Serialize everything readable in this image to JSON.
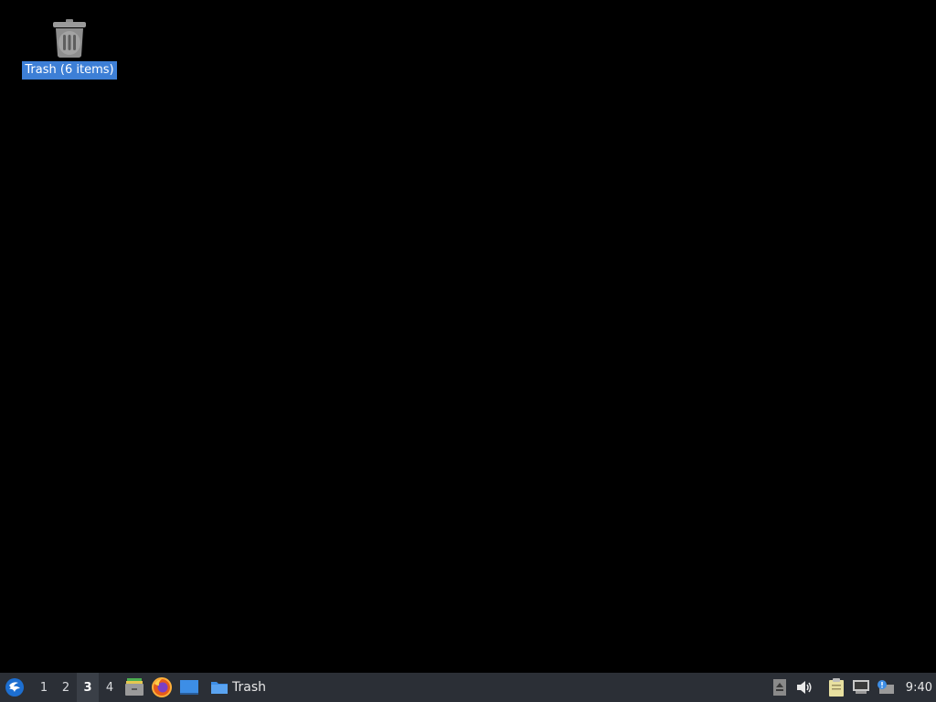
{
  "desktop": {
    "background_color": "#000000",
    "icons": [
      {
        "label": "Trash (6 items)",
        "icon": "trash-icon",
        "selected": true
      }
    ]
  },
  "panel": {
    "menu_icon": "lubuntu-menu-icon",
    "workspaces": [
      {
        "label": "1",
        "active": false
      },
      {
        "label": "2",
        "active": false
      },
      {
        "label": "3",
        "active": true
      },
      {
        "label": "4",
        "active": false
      }
    ],
    "launchers": [
      {
        "icon": "file-manager-icon"
      },
      {
        "icon": "firefox-icon"
      },
      {
        "icon": "show-desktop-icon"
      }
    ],
    "tasks": [
      {
        "label": "Trash",
        "icon": "folder-icon"
      }
    ],
    "tray": [
      {
        "icon": "eject-icon"
      },
      {
        "icon": "volume-icon"
      },
      {
        "icon": "clipboard-icon"
      },
      {
        "icon": "network-icon"
      },
      {
        "icon": "update-notifier-icon"
      }
    ],
    "clock": "9:40"
  },
  "colors": {
    "panel": "#2b2f36",
    "selection": "#3d7fd6"
  }
}
